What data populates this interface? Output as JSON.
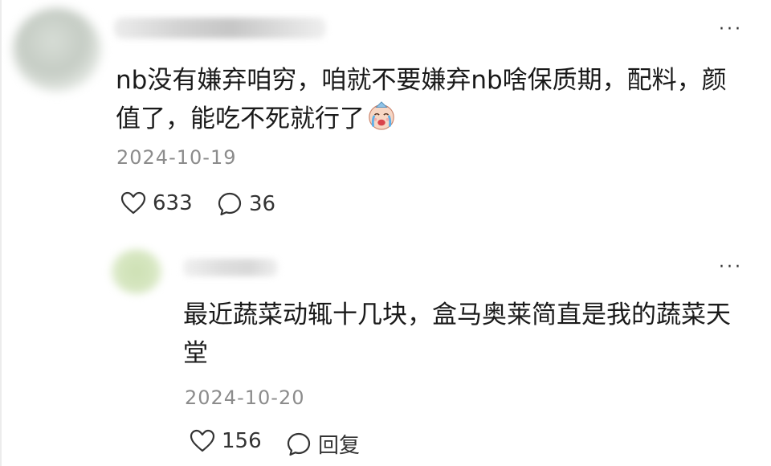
{
  "comment": {
    "content": "nb没有嫌弃咱穷，咱就不要嫌弃nb啥保质期，配料，颜值了，能吃不死就行了",
    "emoji": "crying-face-emoji",
    "date": "2024-10-19",
    "like_count": "633",
    "reply_count": "36",
    "more_label": "···"
  },
  "reply": {
    "content": "最近蔬菜动辄十几块，盒马奥莱简直是我的蔬菜天堂",
    "date": "2024-10-20",
    "like_count": "156",
    "reply_label": "回复",
    "more_label": "···"
  },
  "icons": {
    "like": "heart-outline-icon",
    "comment": "speech-bubble-icon",
    "more": "more-dots-icon"
  }
}
